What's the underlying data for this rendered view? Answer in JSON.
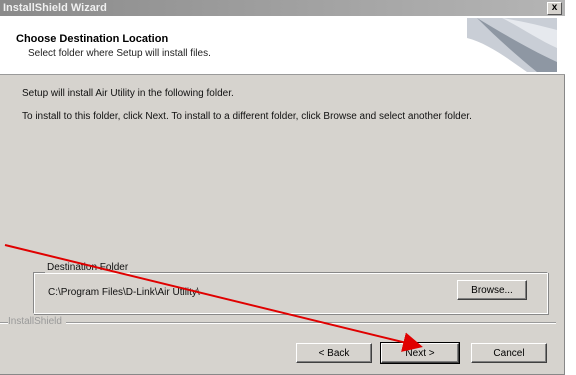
{
  "window": {
    "title": "InstallShield Wizard",
    "close_label": "x"
  },
  "header": {
    "title": "Choose Destination Location",
    "subtitle": "Select folder where Setup will install files."
  },
  "body": {
    "line1": "Setup will install Air Utility in the following folder.",
    "line2": "To install to this folder, click Next. To install to a different folder, click Browse and select another folder."
  },
  "destination": {
    "group_label": "Destination Folder",
    "path": "C:\\Program Files\\D-Link\\Air Utility\\",
    "browse_label": "Browse..."
  },
  "footer": {
    "brand": "InstallShield",
    "back_label": "< Back",
    "next_label": "Next >",
    "cancel_label": "Cancel"
  },
  "colors": {
    "dialog_bg": "#d6d3ce",
    "annotation_arrow": "#e00000"
  }
}
